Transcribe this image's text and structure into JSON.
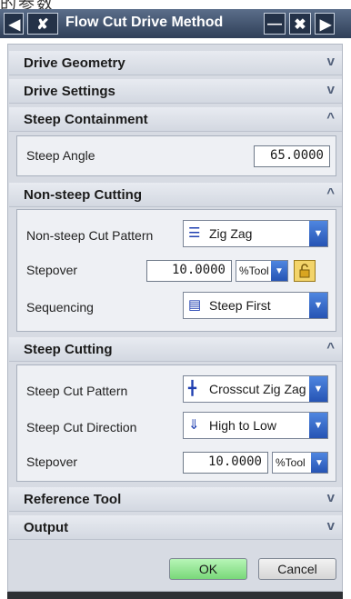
{
  "window": {
    "top_fragment": "的参数",
    "title": "Flow Cut Drive Method",
    "prev_icon": "chevron-left-icon",
    "collapse_icon": "collapse-icon",
    "minimize_icon": "minimize-icon",
    "close_icon": "close-icon",
    "next_icon": "chevron-right-icon"
  },
  "sections": {
    "drive_geometry": {
      "label": "Drive Geometry",
      "chevron": "v"
    },
    "drive_settings": {
      "label": "Drive Settings",
      "chevron": "v"
    },
    "steep_containment": {
      "label": "Steep Containment",
      "chevron": "^",
      "steep_angle_label": "Steep Angle",
      "steep_angle_value": "65.0000"
    },
    "non_steep_cutting": {
      "label": "Non-steep Cutting",
      "chevron": "^",
      "cut_pattern_label": "Non-steep Cut Pattern",
      "cut_pattern_value": "Zig Zag",
      "stepover_label": "Stepover",
      "stepover_value": "10.0000",
      "stepover_unit": "%Tool",
      "sequencing_label": "Sequencing",
      "sequencing_value": "Steep First"
    },
    "steep_cutting": {
      "label": "Steep Cutting",
      "chevron": "^",
      "cut_pattern_label": "Steep Cut Pattern",
      "cut_pattern_value": "Crosscut Zig Zag",
      "cut_direction_label": "Steep Cut Direction",
      "cut_direction_value": "High to Low",
      "stepover_label": "Stepover",
      "stepover_value": "10.0000",
      "stepover_unit": "%Tool"
    },
    "reference_tool": {
      "label": "Reference Tool",
      "chevron": "v"
    },
    "output": {
      "label": "Output",
      "chevron": "v"
    }
  },
  "buttons": {
    "ok": "OK",
    "cancel": "Cancel"
  },
  "colors": {
    "title_bar": "#3f5170",
    "dropdown_arrow": "#2f63c8",
    "ok_button": "#8fe08f",
    "lock": "#f3d46a"
  }
}
